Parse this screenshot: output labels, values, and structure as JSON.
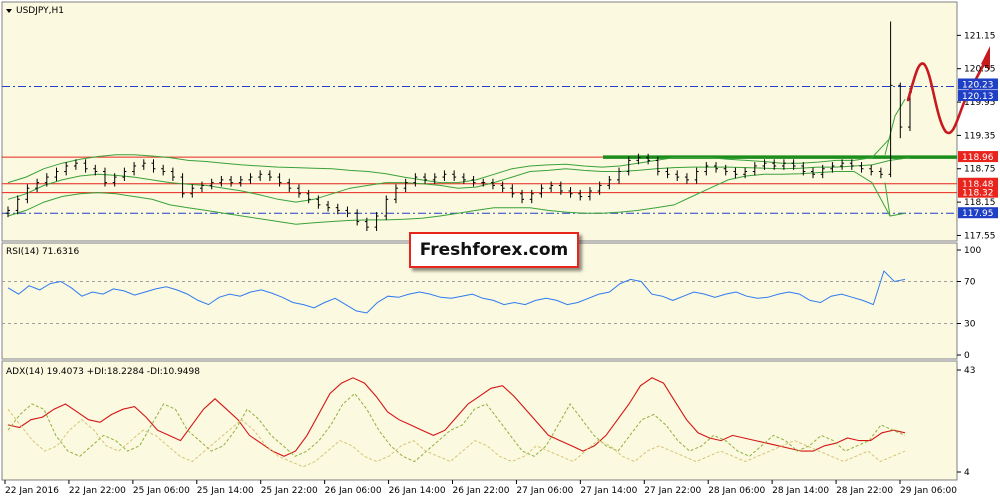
{
  "chart_data": [
    {
      "type": "candlestick",
      "title": "USDJPY,H1",
      "yticks": [
        "121.15",
        "120.55",
        "119.95",
        "119.35",
        "118.75",
        "118.15",
        "117.55"
      ],
      "ylim": [
        117.45,
        121.75
      ],
      "price_tags": [
        {
          "value": "120.23",
          "color": "#1f3fc4"
        },
        {
          "value": "120.13",
          "color": "#1f3fc4"
        },
        {
          "value": "118.96",
          "color": "#e8241c"
        },
        {
          "value": "118.48",
          "color": "#e8241c"
        },
        {
          "value": "118.32",
          "color": "#e8241c"
        },
        {
          "value": "117.95",
          "color": "#1f3fc4"
        }
      ],
      "hlines": [
        {
          "value": 120.23,
          "style": "dashdot",
          "color": "#1f3fc4"
        },
        {
          "value": 118.96,
          "style": "solid",
          "color": "#e8241c"
        },
        {
          "value": 118.48,
          "style": "solid",
          "color": "#e8241c"
        },
        {
          "value": 118.32,
          "style": "solid",
          "color": "#e8241c"
        },
        {
          "value": 117.95,
          "style": "dashdot",
          "color": "#1f3fc4"
        }
      ],
      "close": [
        118.0,
        118.2,
        118.4,
        118.5,
        118.6,
        118.7,
        118.8,
        118.85,
        118.75,
        118.7,
        118.5,
        118.6,
        118.7,
        118.8,
        118.85,
        118.75,
        118.7,
        118.6,
        118.3,
        118.4,
        118.45,
        118.5,
        118.55,
        118.5,
        118.55,
        118.6,
        118.65,
        118.6,
        118.5,
        118.4,
        118.3,
        118.2,
        118.1,
        118.05,
        118.0,
        117.95,
        117.8,
        117.7,
        117.9,
        118.2,
        118.4,
        118.5,
        118.6,
        118.55,
        118.6,
        118.65,
        118.6,
        118.55,
        118.5,
        118.5,
        118.45,
        118.4,
        118.3,
        118.2,
        118.3,
        118.4,
        118.45,
        118.35,
        118.3,
        118.25,
        118.35,
        118.45,
        118.55,
        118.7,
        118.9,
        118.95,
        118.9,
        118.7,
        118.65,
        118.6,
        118.55,
        118.7,
        118.8,
        118.75,
        118.7,
        118.65,
        118.7,
        118.8,
        118.85,
        118.8,
        118.85,
        118.8,
        118.7,
        118.65,
        118.75,
        118.8,
        118.85,
        118.8,
        118.75,
        118.7,
        118.65,
        120.25,
        119.5,
        120.13
      ],
      "bollinger": {
        "upper": [
          118.5,
          118.6,
          118.75,
          118.85,
          118.92,
          118.97,
          119.0,
          119.0,
          118.98,
          118.95,
          118.9,
          118.88,
          118.85,
          118.82,
          118.8,
          118.78,
          118.77,
          118.76,
          118.75,
          118.72,
          118.7,
          118.66,
          118.6,
          118.55,
          118.5,
          118.5,
          118.55,
          118.65,
          118.75,
          118.8,
          118.82,
          118.83,
          118.8,
          118.78,
          118.8,
          118.85,
          118.9,
          118.95,
          118.95,
          118.95,
          118.92,
          118.9,
          118.88,
          118.85,
          118.85,
          118.87,
          118.9,
          118.9,
          118.95,
          119.3
        ],
        "middle": [
          118.2,
          118.3,
          118.45,
          118.55,
          118.62,
          118.65,
          118.63,
          118.6,
          118.55,
          118.5,
          118.47,
          118.45,
          118.4,
          118.35,
          118.28,
          118.2,
          118.15,
          118.2,
          118.3,
          118.4,
          118.45,
          118.5,
          118.5,
          118.48,
          118.45,
          118.4,
          118.42,
          118.5,
          118.6,
          118.7,
          118.72,
          118.75,
          118.72,
          118.7,
          118.7,
          118.72,
          118.75,
          118.77,
          118.78,
          118.78,
          118.78,
          118.77,
          118.76,
          118.75,
          118.76,
          118.78,
          118.78,
          118.8,
          118.82,
          118.9
        ],
        "lower": [
          117.9,
          118.0,
          118.15,
          118.25,
          118.3,
          118.32,
          118.3,
          118.25,
          118.2,
          118.1,
          118.05,
          118.0,
          117.95,
          117.9,
          117.85,
          117.8,
          117.75,
          117.78,
          117.8,
          117.82,
          117.83,
          117.83,
          117.84,
          117.86,
          117.9,
          117.95,
          118.0,
          118.05,
          118.05,
          118.05,
          118.0,
          117.97,
          117.95,
          117.95,
          117.97,
          118.0,
          118.05,
          118.1,
          118.25,
          118.4,
          118.55,
          118.62,
          118.65,
          118.65,
          118.66,
          118.68,
          118.7,
          118.7,
          118.5,
          117.9
        ]
      }
    },
    {
      "type": "line",
      "title": "RSI(14) 71.6316",
      "yticks": [
        "100",
        "70",
        "30",
        "0"
      ],
      "ylim": [
        0,
        100
      ],
      "levels": [
        70,
        30
      ],
      "values": [
        64,
        58,
        66,
        62,
        68,
        70,
        64,
        56,
        60,
        58,
        63,
        61,
        57,
        60,
        63,
        65,
        62,
        58,
        52,
        48,
        55,
        58,
        56,
        60,
        62,
        59,
        55,
        50,
        48,
        45,
        50,
        54,
        48,
        42,
        40,
        50,
        56,
        55,
        58,
        60,
        58,
        55,
        54,
        56,
        58,
        54,
        52,
        48,
        50,
        48,
        52,
        54,
        52,
        48,
        50,
        54,
        58,
        60,
        68,
        72,
        70,
        58,
        56,
        52,
        56,
        60,
        58,
        55,
        58,
        60,
        56,
        54,
        55,
        58,
        60,
        58,
        52,
        50,
        56,
        58,
        55,
        52,
        48,
        80,
        70,
        72
      ]
    },
    {
      "type": "line",
      "title": "ADX(14) 19.4073 +DI:18.2284 -DI:10.9498",
      "yticks": [
        "43",
        "4"
      ],
      "ylim": [
        4,
        43
      ],
      "series": [
        {
          "name": "ADX(14)",
          "values": [
            22,
            21,
            24,
            25,
            28,
            30,
            27,
            24,
            23,
            26,
            28,
            29,
            25,
            20,
            18,
            16,
            22,
            28,
            32,
            28,
            24,
            18,
            15,
            12,
            10,
            12,
            18,
            26,
            34,
            38,
            40,
            38,
            33,
            27,
            24,
            22,
            20,
            18,
            20,
            25,
            30,
            33,
            36,
            37,
            33,
            28,
            23,
            18,
            16,
            14,
            12,
            14,
            18,
            24,
            30,
            37,
            40,
            38,
            31,
            24,
            19,
            17,
            16,
            18,
            17,
            16,
            15,
            14,
            13,
            12,
            12,
            14,
            15,
            17,
            16,
            16,
            19,
            20,
            19
          ]
        },
        {
          "name": "+DI",
          "values": [
            20,
            26,
            30,
            28,
            18,
            12,
            10,
            14,
            18,
            16,
            12,
            14,
            22,
            30,
            28,
            20,
            16,
            12,
            14,
            20,
            28,
            24,
            18,
            14,
            10,
            12,
            16,
            22,
            30,
            34,
            28,
            20,
            14,
            10,
            8,
            12,
            16,
            20,
            22,
            28,
            30,
            24,
            18,
            12,
            10,
            14,
            22,
            30,
            24,
            18,
            14,
            12,
            18,
            24,
            26,
            22,
            16,
            12,
            14,
            18,
            16,
            12,
            10,
            14,
            18,
            16,
            12,
            14,
            18,
            16,
            12,
            14,
            16,
            22,
            20,
            18
          ]
        },
        {
          "name": "-DI",
          "values": [
            28,
            22,
            16,
            12,
            14,
            20,
            24,
            20,
            14,
            12,
            16,
            20,
            18,
            14,
            10,
            8,
            12,
            16,
            20,
            24,
            20,
            14,
            10,
            8,
            6,
            8,
            12,
            16,
            14,
            10,
            8,
            10,
            14,
            16,
            12,
            10,
            8,
            12,
            16,
            14,
            10,
            8,
            10,
            14,
            12,
            10,
            8,
            12,
            16,
            14,
            10,
            8,
            12,
            14,
            12,
            10,
            8,
            10,
            12,
            10,
            8,
            10,
            12,
            14,
            16,
            14,
            12,
            10,
            8,
            10,
            12,
            8,
            10,
            12
          ]
        }
      ]
    }
  ],
  "xaxis": {
    "labels": [
      "22 Jan 2016",
      "22 Jan 22:00",
      "25 Jan 06:00",
      "25 Jan 14:00",
      "25 Jan 22:00",
      "26 Jan 06:00",
      "26 Jan 14:00",
      "26 Jan 22:00",
      "27 Jan 06:00",
      "27 Jan 14:00",
      "27 Jan 22:00",
      "28 Jan 06:00",
      "28 Jan 14:00",
      "28 Jan 22:00",
      "29 Jan 06:00"
    ]
  },
  "watermark": "Freshforex.com",
  "colors": {
    "background": "#fbf9df",
    "candles": "#000000",
    "bollinger": "#3aa23a",
    "support_zone": "#1b8f1b",
    "rsi": "#2f7bf0",
    "adx": "#d41515",
    "plus_di": "#8fb03c",
    "minus_di": "#d8c478",
    "forecast_arrow": "#c8191f"
  }
}
